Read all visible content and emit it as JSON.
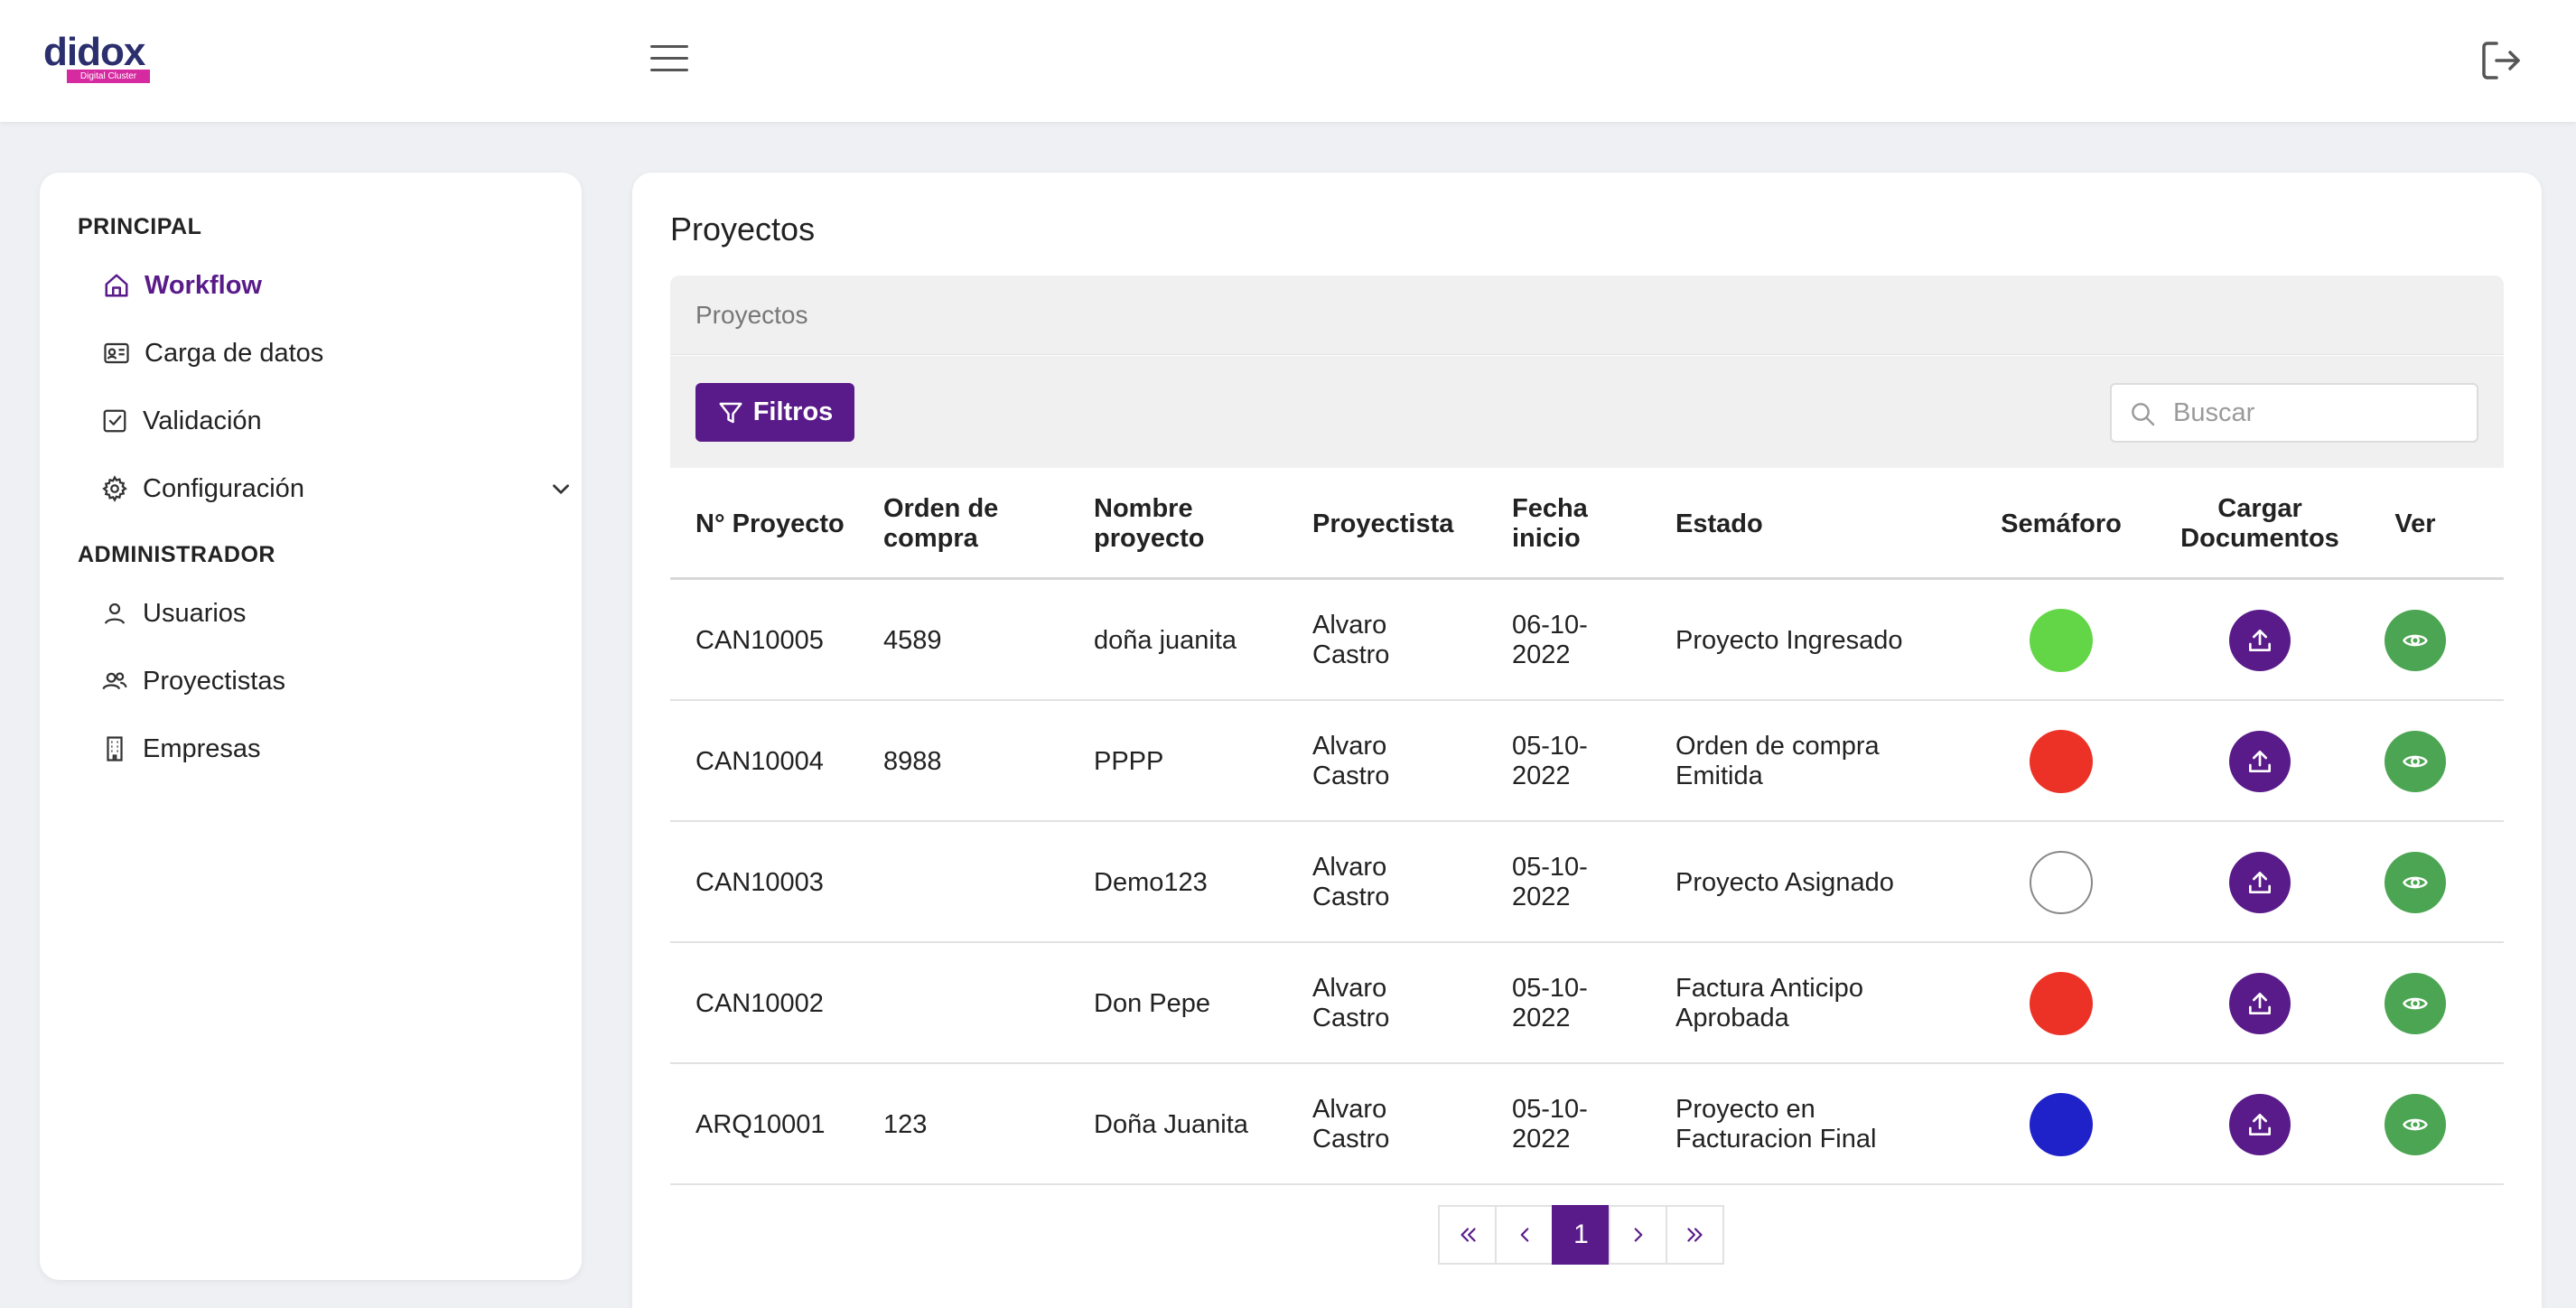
{
  "brand": {
    "name": "didox",
    "tagline": "Digital Cluster",
    "color": "#5a1b8a",
    "logo_color": "#2b2f6e",
    "tagline_bg": "#d62aa0"
  },
  "header": {
    "menu_icon": "hamburger-icon",
    "logout_icon": "logout-icon"
  },
  "sidebar": {
    "sections": [
      {
        "title": "PRINCIPAL",
        "items": [
          {
            "label": "Workflow",
            "icon": "home-icon",
            "active": true
          },
          {
            "label": "Carga de datos",
            "icon": "id-card-icon"
          },
          {
            "label": "Validación",
            "icon": "checkbox-icon"
          },
          {
            "label": "Configuración",
            "icon": "gear-icon",
            "expandable": true
          }
        ]
      },
      {
        "title": "ADMINISTRADOR",
        "items": [
          {
            "label": "Usuarios",
            "icon": "user-icon"
          },
          {
            "label": "Proyectistas",
            "icon": "users-icon"
          },
          {
            "label": "Empresas",
            "icon": "building-icon"
          }
        ]
      }
    ]
  },
  "main": {
    "title": "Proyectos",
    "breadcrumb": "Proyectos",
    "filter_label": "Filtros",
    "search_placeholder": "Buscar",
    "columns": [
      "N° Proyecto",
      "Orden de compra",
      "Nombre proyecto",
      "Proyectista",
      "Fecha inicio",
      "Estado",
      "Semáforo",
      "Cargar Documentos",
      "Ver"
    ],
    "rows": [
      {
        "id": "CAN10005",
        "orden": "4589",
        "nombre": "doña juanita",
        "proyectista": "Alvaro Castro",
        "fecha": "06-10-2022",
        "estado": "Proyecto Ingresado",
        "semaforo": "#62d646"
      },
      {
        "id": "CAN10004",
        "orden": "8988",
        "nombre": "PPPP",
        "proyectista": "Alvaro Castro",
        "fecha": "05-10-2022",
        "estado": "Orden de compra Emitida",
        "semaforo": "#ec3226"
      },
      {
        "id": "CAN10003",
        "orden": "",
        "nombre": "Demo123",
        "proyectista": "Alvaro Castro",
        "fecha": "05-10-2022",
        "estado": "Proyecto Asignado",
        "semaforo": "#ffffff"
      },
      {
        "id": "CAN10002",
        "orden": "",
        "nombre": "Don Pepe",
        "proyectista": "Alvaro Castro",
        "fecha": "05-10-2022",
        "estado": "Factura Anticipo Aprobada",
        "semaforo": "#ec3226"
      },
      {
        "id": "ARQ10001",
        "orden": "123",
        "nombre": "Doña Juanita",
        "proyectista": "Alvaro Castro",
        "fecha": "05-10-2022",
        "estado": "Proyecto en Facturacion Final",
        "semaforo": "#1f22c9"
      }
    ],
    "upload_icon": "upload-icon",
    "view_icon": "eye-icon",
    "pagination": {
      "current": "1",
      "first": "«",
      "prev": "‹",
      "next": "›",
      "last": "»"
    }
  }
}
